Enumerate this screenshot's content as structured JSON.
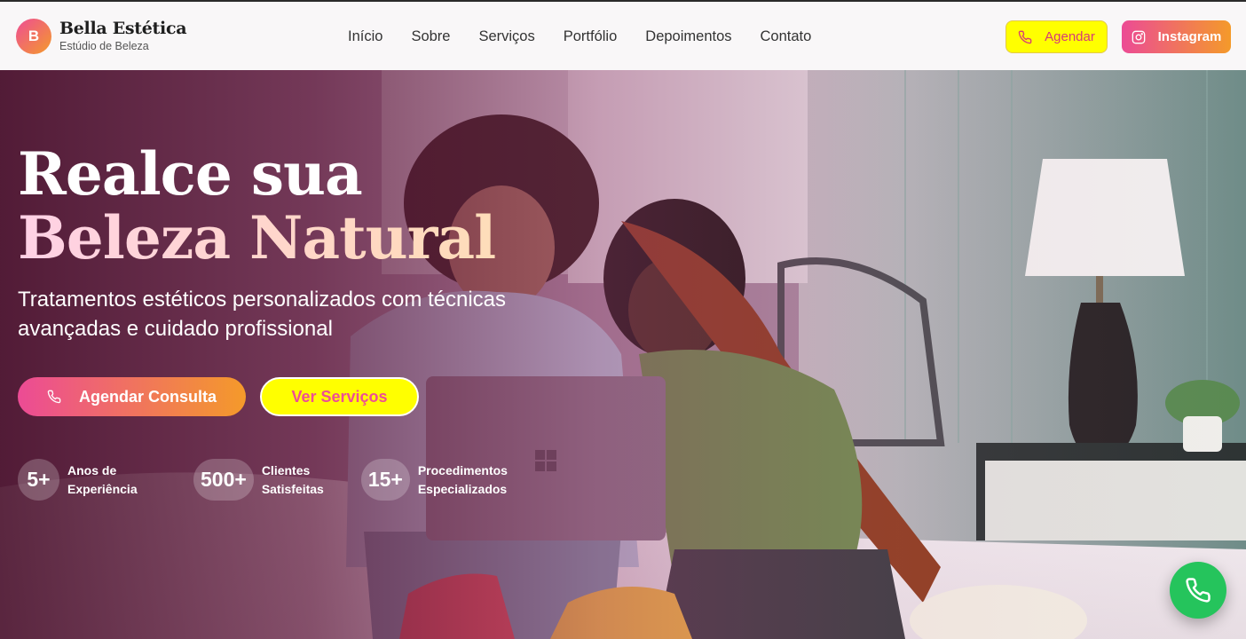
{
  "brand": {
    "initial": "B",
    "name": "Bella Estética",
    "tagline": "Estúdio de Beleza"
  },
  "nav": {
    "items": [
      "Início",
      "Sobre",
      "Serviços",
      "Portfólio",
      "Depoimentos",
      "Contato"
    ]
  },
  "header_actions": {
    "schedule_label": "Agendar",
    "instagram_label": "Instagram"
  },
  "hero": {
    "headline_line1": "Realce sua",
    "headline_line2": "Beleza Natural",
    "subtitle": "Tratamentos estéticos personalizados com técnicas avançadas e cuidado profissional",
    "primary_cta": "Agendar Consulta",
    "secondary_cta": "Ver Serviços"
  },
  "stats": [
    {
      "value": "5+",
      "label_line1": "Anos de",
      "label_line2": "Experiência"
    },
    {
      "value": "500+",
      "label_line1": "Clientes",
      "label_line2": "Satisfeitas"
    },
    {
      "value": "15+",
      "label_line1": "Procedimentos",
      "label_line2": "Especializados"
    }
  ],
  "icons": {
    "logo": "brand-initial-badge",
    "schedule": "phone-icon",
    "instagram": "instagram-icon",
    "consult": "phone-icon",
    "fab": "whatsapp-phone-icon"
  },
  "colors": {
    "accent_pink": "#ec4b95",
    "accent_orange": "#f49a2a",
    "highlight_yellow": "#ffff00",
    "whatsapp_green": "#25c45c",
    "header_bg": "#f9f7f8"
  }
}
